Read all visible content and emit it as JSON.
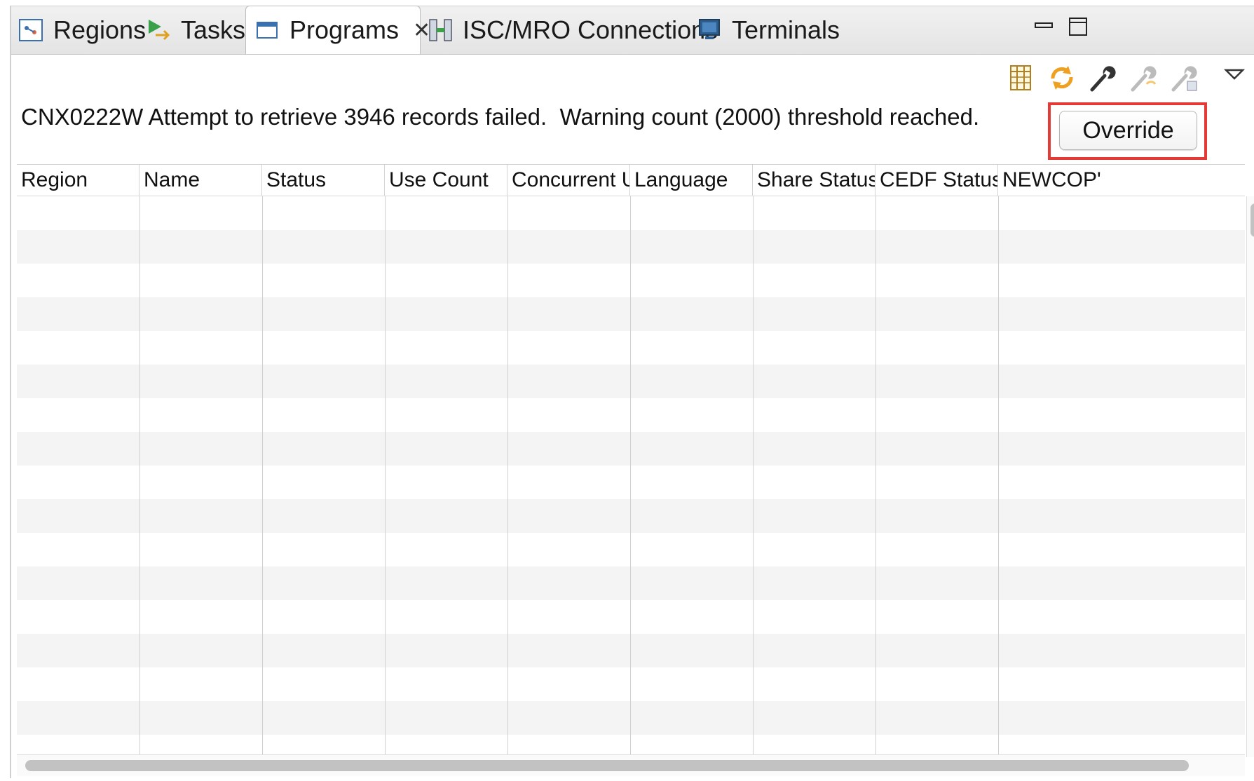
{
  "tabs": [
    {
      "label": "Regions",
      "icon": "regions-icon"
    },
    {
      "label": "Tasks",
      "icon": "tasks-icon"
    },
    {
      "label": "Programs",
      "icon": "programs-icon",
      "active": true,
      "close": "✕"
    },
    {
      "label": "ISC/MRO Connections",
      "icon": "connections-icon"
    },
    {
      "label": "Terminals",
      "icon": "terminals-icon"
    }
  ],
  "window_controls": {
    "minimize": "minimize-icon",
    "maximize": "maximize-icon"
  },
  "toolbar": [
    "columns-icon",
    "refresh-icon",
    "wrench-icon",
    "wrench-apply-icon",
    "wrench-save-icon",
    "view-menu-icon"
  ],
  "message": {
    "text": "CNX0222W Attempt to retrieve 3946 records failed.  Warning count (2000) threshold reached.",
    "override_label": "Override",
    "highlight_color": "#e53935"
  },
  "table": {
    "columns": [
      "Region",
      "Name",
      "Status",
      "Use Count",
      "Concurrent U",
      "Language",
      "Share Status",
      "CEDF Status",
      "NEWCOP'"
    ],
    "rows": []
  },
  "colors": {
    "stripe": "#f4f4f4",
    "accent_orange": "#f0a020",
    "icon_blue": "#3a6fb0"
  }
}
